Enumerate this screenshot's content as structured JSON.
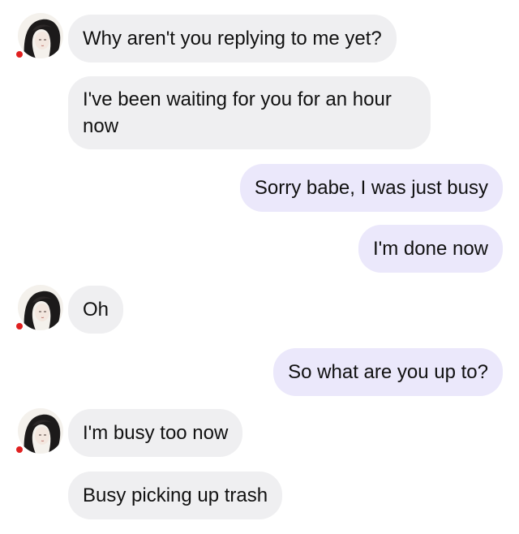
{
  "colors": {
    "incoming_bubble": "#efeff1",
    "outgoing_bubble": "#ebe8fb",
    "presence_dot": "#e02020",
    "text": "#111111"
  },
  "contact": {
    "avatar_icon": "girl-portrait-avatar",
    "presence_icon": "red-status-dot"
  },
  "messages": [
    {
      "direction": "incoming",
      "text": "Why aren't you replying to me yet?"
    },
    {
      "direction": "incoming",
      "text": "I've been waiting for you for an hour now"
    },
    {
      "direction": "outgoing",
      "text": "Sorry babe, I was just busy"
    },
    {
      "direction": "outgoing",
      "text": "I'm done now"
    },
    {
      "direction": "incoming",
      "text": "Oh"
    },
    {
      "direction": "outgoing",
      "text": "So what are you up to?"
    },
    {
      "direction": "incoming",
      "text": "I'm busy too now"
    },
    {
      "direction": "incoming",
      "text": "Busy picking up trash"
    }
  ]
}
